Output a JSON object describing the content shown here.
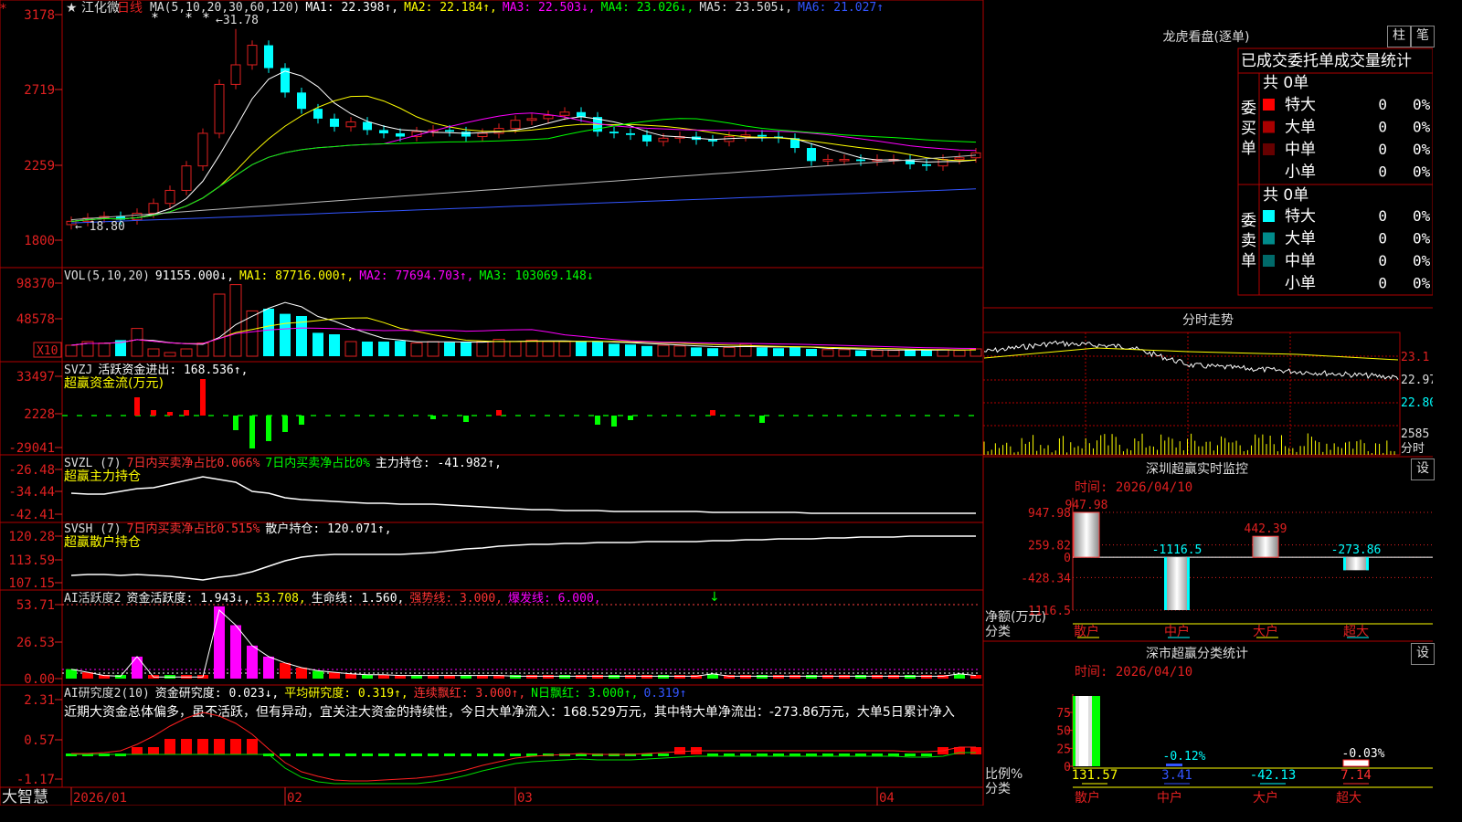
{
  "stock": {
    "star": "★",
    "name": "江化微",
    "period": "日线"
  },
  "main_panel": {
    "ma_header": [
      {
        "text": "MA(5,10,20,30,60,120)",
        "color": "#dddddd"
      },
      {
        "text": "MA1: 22.398↑,",
        "color": "#ffffff"
      },
      {
        "text": "MA2: 22.184↑,",
        "color": "#ffff00"
      },
      {
        "text": "MA3: 22.503↓,",
        "color": "#ff00ff"
      },
      {
        "text": "MA4: 23.026↓,",
        "color": "#00ff00"
      },
      {
        "text": "MA5: 23.505↓,",
        "color": "#dddddd"
      },
      {
        "text": "MA6: 21.027↑",
        "color": "#3355ff"
      }
    ],
    "price_labels": [
      "3178",
      "2719",
      "2259",
      "1800"
    ],
    "high_mark": "31.78",
    "low_mark": "18.80",
    "stars": [
      "*",
      "*",
      "*"
    ]
  },
  "vol_panel": {
    "header": [
      {
        "text": "VOL(5,10,20)",
        "color": "#dddddd"
      },
      {
        "text": "91155.000↓,",
        "color": "#ffffff"
      },
      {
        "text": "MA1: 87716.000↑,",
        "color": "#ffff00"
      },
      {
        "text": "MA2: 77694.703↑,",
        "color": "#ff00ff"
      },
      {
        "text": "MA3: 103069.148↓",
        "color": "#00ff00"
      }
    ],
    "labels": [
      "98370",
      "48578"
    ],
    "unit": "X10"
  },
  "svzj_panel": {
    "header": [
      {
        "text": "SVZJ",
        "color": "#dddddd"
      },
      {
        "text": "活跃资金进出: 168.536↑,",
        "color": "#ffffff"
      }
    ],
    "subtitle": "超赢资金流(万元)",
    "labels": [
      "33497",
      "2228",
      "-29041"
    ]
  },
  "svzl_panel": {
    "header": [
      {
        "text": "SVZL (7)",
        "color": "#dddddd"
      },
      {
        "text": "7日内买卖净占比0.066%",
        "color": "#ff3333"
      },
      {
        "text": "7日内买卖净占比0%",
        "color": "#00ff00"
      },
      {
        "text": "主力持仓: -41.982↑,",
        "color": "#ffffff"
      }
    ],
    "subtitle": "超赢主力持仓",
    "labels": [
      "-26.48",
      "-34.44",
      "-42.41"
    ]
  },
  "svsh_panel": {
    "header": [
      {
        "text": "SVSH (7)",
        "color": "#dddddd"
      },
      {
        "text": "7日内买卖净占比0.515%",
        "color": "#ff3333"
      },
      {
        "text": "散户持仓: 120.071↑,",
        "color": "#ffffff"
      }
    ],
    "subtitle": "超赢散户持仓",
    "labels": [
      "120.28",
      "113.59",
      "107.15"
    ]
  },
  "ai_active_panel": {
    "header": [
      {
        "text": "AI活跃度2",
        "color": "#dddddd"
      },
      {
        "text": "资金活跃度: 1.943↓,",
        "color": "#ffffff"
      },
      {
        "text": "53.708,",
        "color": "#ffff00"
      },
      {
        "text": "生命线: 1.560,",
        "color": "#ffffff"
      },
      {
        "text": "强势线: 3.000,",
        "color": "#ff3333"
      },
      {
        "text": "爆发线: 6.000,",
        "color": "#ff00ff"
      }
    ],
    "labels": [
      "53.71",
      "26.53",
      "0.00"
    ]
  },
  "ai_research_panel": {
    "header": [
      {
        "text": "AI研究度2(10)",
        "color": "#dddddd"
      },
      {
        "text": "资金研究度: 0.023↓,",
        "color": "#ffffff"
      },
      {
        "text": "平均研究度: 0.319↑,",
        "color": "#ffff00"
      },
      {
        "text": "连续飘红: 3.000↑,",
        "color": "#ff3333"
      },
      {
        "text": "N日飘红: 3.000↑,",
        "color": "#00ff00"
      },
      {
        "text": "0.319↑",
        "color": "#3355ff"
      }
    ],
    "comment": "近期大资金总体偏多，虽不活跃，但有异动，宜关注大资金的持续性，今日大单净流入：168.529万元，其中特大单净流出：-273.86万元，大单5日累计净入",
    "labels": [
      "2.31",
      "0.57",
      "-1.17"
    ]
  },
  "x_axis": {
    "dates": [
      "2026/01",
      "02",
      "03",
      "04"
    ]
  },
  "brand": "大智慧",
  "right_panel": {
    "dragon": {
      "title": "龙虎看盘(逐单)",
      "buttons": [
        "柱",
        "笔"
      ],
      "subtitle": "已成交委托单成交量统计",
      "buy_label": "委买单",
      "sell_label": "委卖单",
      "buy_total": "共 0单",
      "sell_total": "共 0单",
      "buy_rows": [
        {
          "label": "特大",
          "count": "0",
          "pct": "0%",
          "color": "#ff0000"
        },
        {
          "label": "大单",
          "count": "0",
          "pct": "0%",
          "color": "#aa0000"
        },
        {
          "label": "中单",
          "count": "0",
          "pct": "0%",
          "color": "#660000"
        },
        {
          "label": "小单",
          "count": "0",
          "pct": "0%",
          "color": "#000000"
        }
      ],
      "sell_rows": [
        {
          "label": "特大",
          "count": "0",
          "pct": "0%",
          "color": "#00ffff"
        },
        {
          "label": "大单",
          "count": "0",
          "pct": "0%",
          "color": "#008b8b"
        },
        {
          "label": "中单",
          "count": "0",
          "pct": "0%",
          "color": "#006a6a"
        },
        {
          "label": "小单",
          "count": "0",
          "pct": "0%",
          "color": "#000000"
        }
      ]
    },
    "intraday": {
      "title": "分时走势",
      "labels": [
        "23.1",
        "22.97",
        "22.80"
      ],
      "vol_label": "2585",
      "vol_unit": "分时"
    },
    "monitor": {
      "title": "深圳超赢实时监控",
      "button": "设",
      "time": "时间: 2026/04/10",
      "y_labels": [
        "947.98",
        "259.82",
        "0",
        "-428.34",
        "-1116.5"
      ],
      "unit": "净额(万元)",
      "cat_label": "分类"
    },
    "classify": {
      "title": "深市超赢分类统计",
      "button": "设",
      "time": "时间: 2026/04/10",
      "y_labels": [
        "75",
        "50",
        "25",
        "0"
      ],
      "unit": "比例%",
      "cat_label": "分类"
    }
  },
  "chart_data": [
    {
      "type": "bar",
      "title": "深圳超赢实时监控",
      "ylabel": "净额(万元)",
      "categories": [
        "散户",
        "中户",
        "大户",
        "超大"
      ],
      "values": [
        947.98,
        -1116.5,
        442.39,
        -273.86
      ],
      "ylim": [
        -1116.5,
        947.98
      ]
    },
    {
      "type": "bar",
      "title": "深市超赢分类统计",
      "ylabel": "比例%",
      "categories": [
        "散户",
        "中户",
        "大户",
        "超大"
      ],
      "values": [
        131.57,
        3.41,
        -42.13,
        7.14
      ],
      "annotations": [
        "-0.12%",
        "-0.03%"
      ],
      "ylim": [
        0,
        75
      ]
    }
  ]
}
